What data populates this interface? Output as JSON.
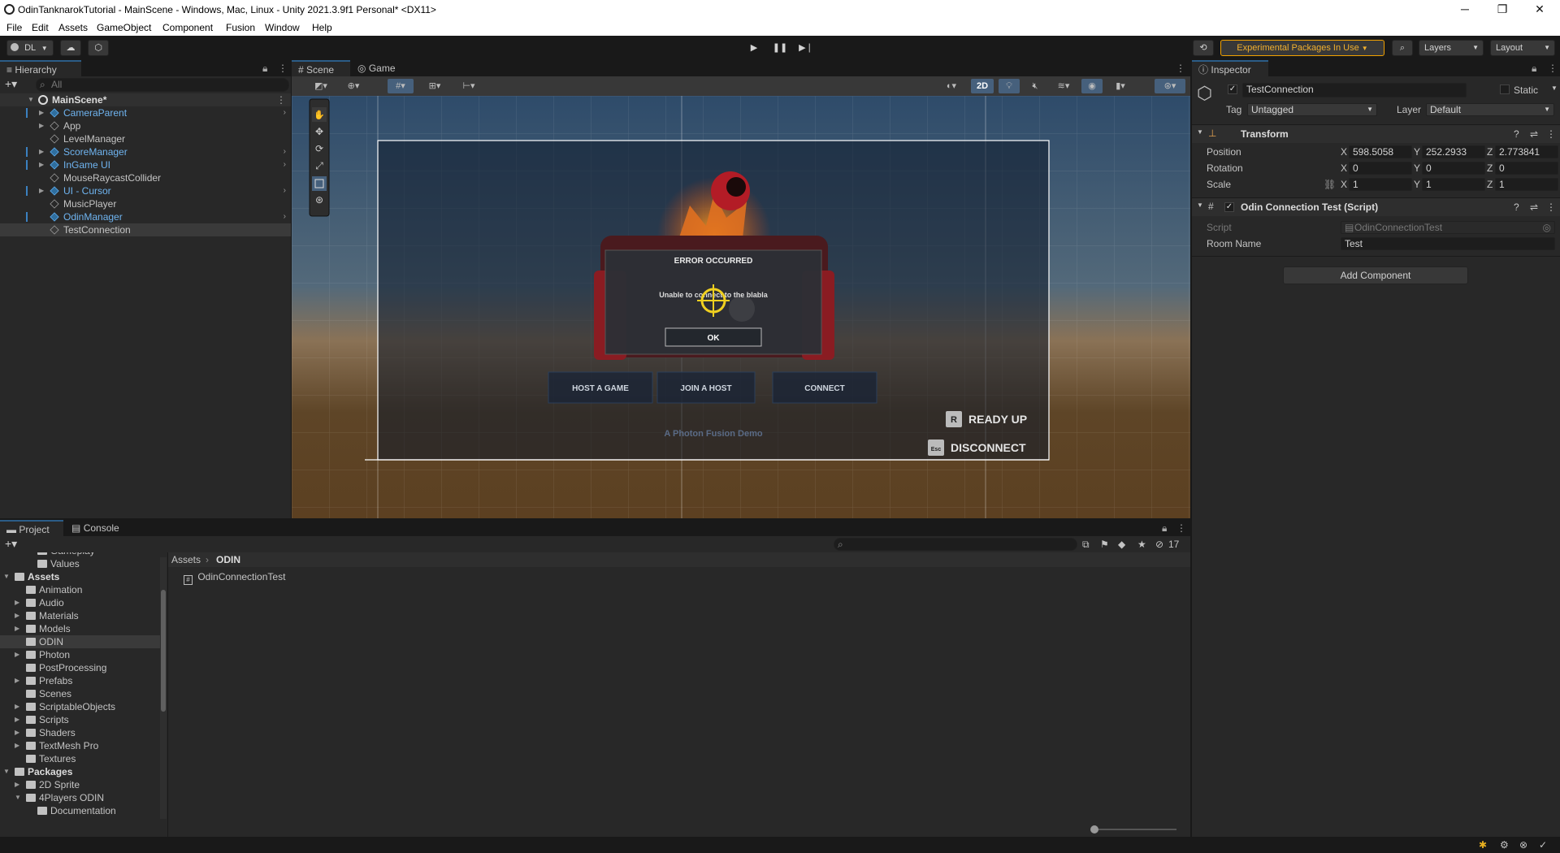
{
  "window": {
    "title": "OdinTanknarokTutorial - MainScene - Windows, Mac, Linux - Unity 2021.3.9f1 Personal* <DX11>",
    "minimize": "─",
    "maximize": "❐",
    "close": "✕"
  },
  "menu": [
    "File",
    "Edit",
    "Assets",
    "GameObject",
    "Component",
    "Fusion",
    "Window",
    "Help"
  ],
  "toolbar": {
    "account": "DL",
    "experimental": "Experimental Packages In Use",
    "layers": "Layers",
    "layout": "Layout"
  },
  "hierarchy": {
    "tab": "Hierarchy",
    "search_placeholder": "All",
    "scene": "MainScene*",
    "items": [
      {
        "label": "CameraParent",
        "blue": true,
        "arrow": true,
        "chev": true
      },
      {
        "label": "App",
        "blue": false,
        "arrow": true,
        "chev": false
      },
      {
        "label": "LevelManager",
        "blue": false,
        "arrow": false,
        "chev": false
      },
      {
        "label": "ScoreManager",
        "blue": true,
        "arrow": true,
        "chev": true
      },
      {
        "label": "InGame UI",
        "blue": true,
        "arrow": true,
        "chev": true
      },
      {
        "label": "MouseRaycastCollider",
        "blue": false,
        "arrow": false,
        "chev": false
      },
      {
        "label": "UI - Cursor",
        "blue": true,
        "arrow": true,
        "chev": true
      },
      {
        "label": "MusicPlayer",
        "blue": false,
        "arrow": false,
        "chev": false
      },
      {
        "label": "OdinManager",
        "blue": true,
        "arrow": false,
        "chev": true
      },
      {
        "label": "TestConnection",
        "blue": false,
        "arrow": false,
        "chev": false,
        "selected": true
      }
    ]
  },
  "scene": {
    "tabs": [
      "Scene",
      "Game"
    ],
    "mode_2d": "2D",
    "dialog": {
      "title": "ERROR OCCURRED",
      "message": "Unable to connect to the blabla",
      "ok": "OK"
    },
    "buttons": [
      "HOST A GAME",
      "JOIN A HOST",
      "CONNECT"
    ],
    "ready": {
      "key": "R",
      "label": "READY UP"
    },
    "disconnect": {
      "key": "Esc",
      "label": "DISCONNECT"
    },
    "footer": "A Photon Fusion Demo"
  },
  "inspector": {
    "tab": "Inspector",
    "object_name": "TestConnection",
    "static": "Static",
    "tag_label": "Tag",
    "tag": "Untagged",
    "layer_label": "Layer",
    "layer": "Default",
    "transform": {
      "title": "Transform",
      "position": {
        "label": "Position",
        "x": "598.5058",
        "y": "252.2933",
        "z": "2.773841"
      },
      "rotation": {
        "label": "Rotation",
        "x": "0",
        "y": "0",
        "z": "0"
      },
      "scale": {
        "label": "Scale",
        "x": "1",
        "y": "1",
        "z": "1"
      }
    },
    "script_comp": {
      "title": "Odin Connection Test (Script)",
      "script_label": "Script",
      "script": "OdinConnectionTest",
      "room_label": "Room Name",
      "room": "Test"
    },
    "add_component": "Add Component"
  },
  "project": {
    "tabs": [
      "Project",
      "Console"
    ],
    "count": "17",
    "breadcrumb": [
      "Assets",
      "ODIN"
    ],
    "file": "OdinConnectionTest",
    "tree": [
      {
        "label": "Gameplay",
        "level": 2,
        "arrow": false
      },
      {
        "label": "Values",
        "level": 2,
        "arrow": false
      },
      {
        "label": "Assets",
        "level": 0,
        "arrow": true,
        "bold": true
      },
      {
        "label": "Animation",
        "level": 1,
        "arrow": false
      },
      {
        "label": "Audio",
        "level": 1,
        "arrow": true
      },
      {
        "label": "Materials",
        "level": 1,
        "arrow": true
      },
      {
        "label": "Models",
        "level": 1,
        "arrow": true
      },
      {
        "label": "ODIN",
        "level": 1,
        "arrow": false,
        "selected": true
      },
      {
        "label": "Photon",
        "level": 1,
        "arrow": true
      },
      {
        "label": "PostProcessing",
        "level": 1,
        "arrow": false
      },
      {
        "label": "Prefabs",
        "level": 1,
        "arrow": true
      },
      {
        "label": "Scenes",
        "level": 1,
        "arrow": false
      },
      {
        "label": "ScriptableObjects",
        "level": 1,
        "arrow": true
      },
      {
        "label": "Scripts",
        "level": 1,
        "arrow": true
      },
      {
        "label": "Shaders",
        "level": 1,
        "arrow": true
      },
      {
        "label": "TextMesh Pro",
        "level": 1,
        "arrow": true
      },
      {
        "label": "Textures",
        "level": 1,
        "arrow": false
      },
      {
        "label": "Packages",
        "level": 0,
        "arrow": true,
        "bold": true
      },
      {
        "label": "2D Sprite",
        "level": 1,
        "arrow": true
      },
      {
        "label": "4Players ODIN",
        "level": 1,
        "arrow": true,
        "open": true
      },
      {
        "label": "Documentation",
        "level": 2,
        "arrow": false
      }
    ]
  }
}
